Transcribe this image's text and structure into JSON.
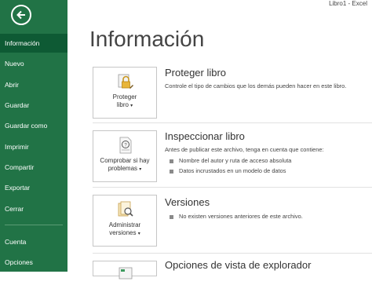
{
  "window": {
    "title": "Libro1 - Excel"
  },
  "sidebar": {
    "items": [
      {
        "label": "Información"
      },
      {
        "label": "Nuevo"
      },
      {
        "label": "Abrir"
      },
      {
        "label": "Guardar"
      },
      {
        "label": "Guardar como"
      },
      {
        "label": "Imprimir"
      },
      {
        "label": "Compartir"
      },
      {
        "label": "Exportar"
      },
      {
        "label": "Cerrar"
      },
      {
        "label": "Cuenta"
      },
      {
        "label": "Opciones"
      }
    ],
    "active": "Información"
  },
  "main": {
    "title": "Información",
    "sections": [
      {
        "button_line1": "Proteger",
        "button_line2": "libro",
        "title": "Proteger libro",
        "text": "Controle el tipo de cambios que los demás pueden hacer en este libro."
      },
      {
        "button_line1": "Comprobar si hay",
        "button_line2": "problemas",
        "title": "Inspeccionar libro",
        "text": "Antes de publicar este archivo, tenga en cuenta que contiene:",
        "bullets": [
          "Nombre del autor y ruta de acceso absoluta",
          "Datos incrustados en un modelo de datos"
        ]
      },
      {
        "button_line1": "Administrar",
        "button_line2": "versiones",
        "title": "Versiones",
        "bullets": [
          "No existen versiones anteriores de este archivo."
        ]
      },
      {
        "title": "Opciones de vista de explorador"
      }
    ]
  },
  "colors": {
    "sidebar": "#217346",
    "sidebar_active": "#0e5a34"
  }
}
